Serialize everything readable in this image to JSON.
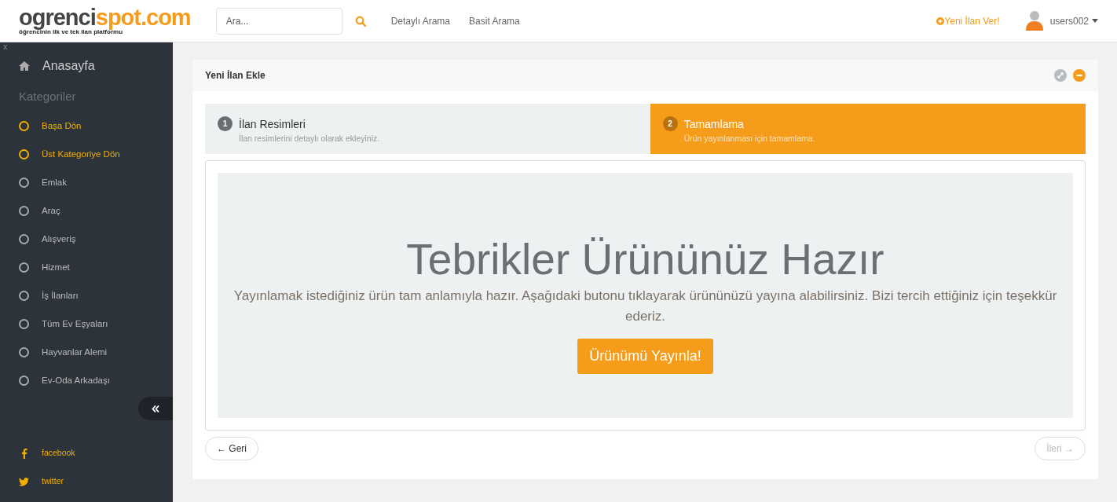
{
  "logo": {
    "dark": "ogrenci",
    "accent": "spot.com",
    "tagline": "öğrencinin ilk ve tek ilan platformu"
  },
  "search": {
    "placeholder": "Ara..."
  },
  "nav_links": [
    "Detaylı Arama",
    "Basit Arama"
  ],
  "new_listing": "Yeni İlan Ver!",
  "user": {
    "name": "users002"
  },
  "sidebar": {
    "close": "x",
    "home": "Anasayfa",
    "heading": "Kategoriler",
    "items": [
      {
        "label": "Başa Dön",
        "kind": "action"
      },
      {
        "label": "Üst Kategoriye Dön",
        "kind": "action"
      },
      {
        "label": "Emlak",
        "kind": "category"
      },
      {
        "label": "Araç",
        "kind": "category"
      },
      {
        "label": "Alışveriş",
        "kind": "category"
      },
      {
        "label": "Hizmet",
        "kind": "category"
      },
      {
        "label": "İş İlanları",
        "kind": "category"
      },
      {
        "label": "Tüm Ev Eşyaları",
        "kind": "category"
      },
      {
        "label": "Hayvanlar Alemi",
        "kind": "category"
      },
      {
        "label": "Ev-Oda Arkadaşı",
        "kind": "category"
      }
    ],
    "social": [
      {
        "label": "facebook",
        "kind": "facebook"
      },
      {
        "label": "twitter",
        "kind": "twitter"
      }
    ]
  },
  "panel": {
    "title": "Yeni İlan Ekle",
    "steps": [
      {
        "number": "1",
        "title": "İlan Resimleri",
        "subtitle": "İlan resimlerini detaylı olarak ekleyiniz.",
        "selected": false
      },
      {
        "number": "2",
        "title": "Tamamlama",
        "subtitle": "Ürün yayınlanması için tamamlama.",
        "selected": true
      }
    ],
    "heading": "Tebrikler Ürününüz Hazır",
    "message": "Yayınlamak istediğiniz ürün tam anlamıyla hazır. Aşağıdaki butonu tıklayarak ürününüzü yayına alabilirsiniz. Bizi tercih ettiğiniz için teşekkür ederiz.",
    "publish_button": "Ürünümü Yayınla!",
    "prev": {
      "label": "← Geri",
      "disabled": false
    },
    "next": {
      "label": "İleri →",
      "disabled": true
    }
  }
}
